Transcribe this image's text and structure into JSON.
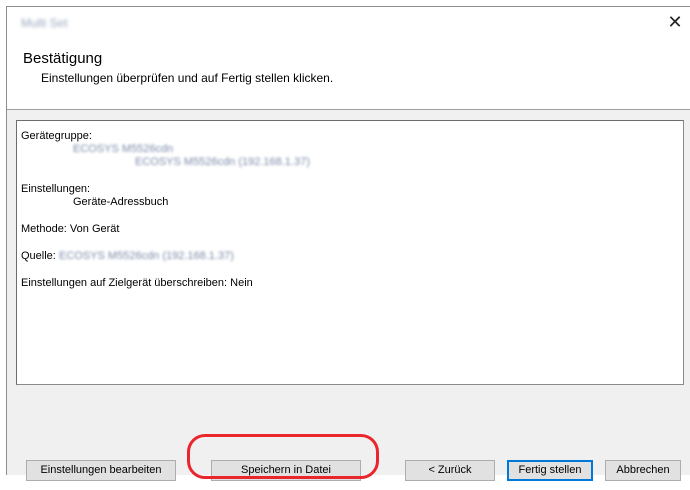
{
  "window": {
    "title": "Multi Set",
    "close_glyph": "✕"
  },
  "header": {
    "title": "Bestätigung",
    "subtitle": "Einstellungen überprüfen und auf Fertig stellen klicken."
  },
  "summary": {
    "device_group_label": "Gerätegruppe:",
    "device_group_name": "ECOSYS M5526cdn",
    "device_group_device": "ECOSYS M5526cdn (192.168.1.37)",
    "settings_label": "Einstellungen:",
    "settings_value": "Geräte-Adressbuch",
    "method_text": "Methode: Von Gerät",
    "source_label": "Quelle:",
    "source_value": "ECOSYS M5526cdn (192.168.1.37)",
    "overwrite_text": "Einstellungen auf Zielgerät überschreiben: Nein"
  },
  "buttons": {
    "edit_settings": "Einstellungen bearbeiten",
    "save_to_file": "Speichern in Datei",
    "back": "< Zurück",
    "finish": "Fertig stellen",
    "cancel": "Abbrechen"
  },
  "colors": {
    "highlight": "#e8262b",
    "focus_border": "#0078d7"
  }
}
